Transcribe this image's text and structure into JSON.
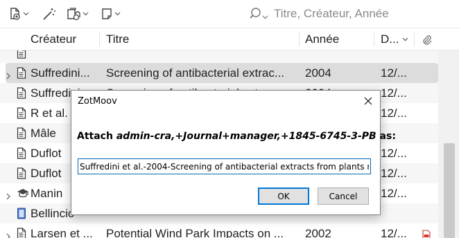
{
  "toolbar": {
    "search_placeholder": "Titre, Créateur, Année",
    "icons": [
      "new-item-icon",
      "magic-wand-icon",
      "add-attachment-icon",
      "new-note-icon",
      "search-icon"
    ]
  },
  "columns": {
    "creator": "Créateur",
    "title": "Titre",
    "year": "Année",
    "date": "D..."
  },
  "rows": [
    {
      "creator": "",
      "title": "",
      "year": "",
      "date": "",
      "type": "document",
      "twisty": false,
      "attachment": false
    },
    {
      "creator": "Suffredini...",
      "title": "Screening of antibacterial extrac...",
      "year": "2004",
      "date": "12/...",
      "type": "document",
      "twisty": true,
      "attachment": false
    },
    {
      "creator": "Suffredini...",
      "title": "Screening of antibacterial extrac...",
      "year": "2004",
      "date": "12/...",
      "type": "document",
      "twisty": false,
      "attachment": false
    },
    {
      "creator": "R et al.",
      "title": "",
      "year": "",
      "date": "12/...",
      "type": "document",
      "twisty": false,
      "attachment": false
    },
    {
      "creator": "Mâle",
      "title": "",
      "year": "",
      "date": "",
      "type": "document",
      "twisty": false,
      "attachment": false
    },
    {
      "creator": "Duflot",
      "title": "",
      "year": "",
      "date": "12/...",
      "type": "document",
      "twisty": false,
      "attachment": false
    },
    {
      "creator": "Duflot",
      "title": "",
      "year": "",
      "date": "12/...",
      "type": "document",
      "twisty": false,
      "attachment": false
    },
    {
      "creator": "Manin",
      "title": "",
      "year": "",
      "date": "12/...",
      "type": "thesis",
      "twisty": true,
      "attachment": false
    },
    {
      "creator": "Bellincio",
      "title": "",
      "year": "",
      "date": "",
      "type": "book",
      "twisty": false,
      "attachment": false
    },
    {
      "creator": "Larsen et ...",
      "title": "Potential Wind Park Impacts on ...",
      "year": "2002",
      "date": "12/...",
      "type": "document",
      "twisty": true,
      "attachment": true
    }
  ],
  "dialog": {
    "title": "ZotMoov",
    "message_prefix": "Attach ",
    "message_name": "admin-cra,+Journal+manager,+1845-6745-3-PB",
    "message_suffix": " as:",
    "input_value": "Suffredini et al.-2004-Screening of antibacterial extracts from plants na",
    "ok_label": "OK",
    "cancel_label": "Cancel"
  }
}
